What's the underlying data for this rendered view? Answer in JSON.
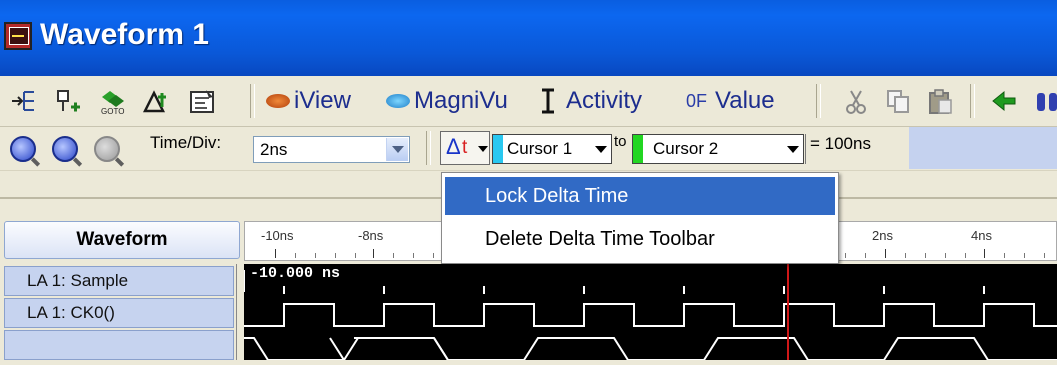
{
  "window": {
    "title": "Waveform 1"
  },
  "toolbar1": {
    "buttons": [
      {
        "label": "iView",
        "icon": "iview-icon"
      },
      {
        "label": "MagniVu",
        "icon": "magnivu-icon"
      },
      {
        "label": "Activity",
        "icon": "activity-icon"
      },
      {
        "label": "Value",
        "icon": "value-icon",
        "icon_text": "0F"
      }
    ]
  },
  "toolbar2": {
    "time_div_label": "Time/Div:",
    "time_div_value": "2ns",
    "cursor1": "Cursor 1",
    "to_label": "to",
    "cursor2": "Cursor 2",
    "delta_value": "= 100ns",
    "delta_glyph": "Δ",
    "t_glyph": "t"
  },
  "menu": {
    "items": [
      {
        "label": "Lock Delta Time",
        "selected": true
      },
      {
        "label": "Delete Delta Time Toolbar",
        "selected": false
      }
    ]
  },
  "waveform": {
    "column_header": "Waveform",
    "ruler_ticks": [
      "-10ns",
      "-8ns",
      "2ns",
      "4ns"
    ],
    "cursor_readout": "-10.000 ns",
    "signals": [
      "LA 1: Sample",
      "LA 1: CK0()"
    ]
  },
  "colors": {
    "title_blue": "#0a5ee0",
    "menu_highlight": "#316ac5",
    "cursor1": "#29c8f0",
    "cursor2": "#22d622",
    "cursor_line": "#d01818",
    "signal_row": "#c6d3ef"
  }
}
